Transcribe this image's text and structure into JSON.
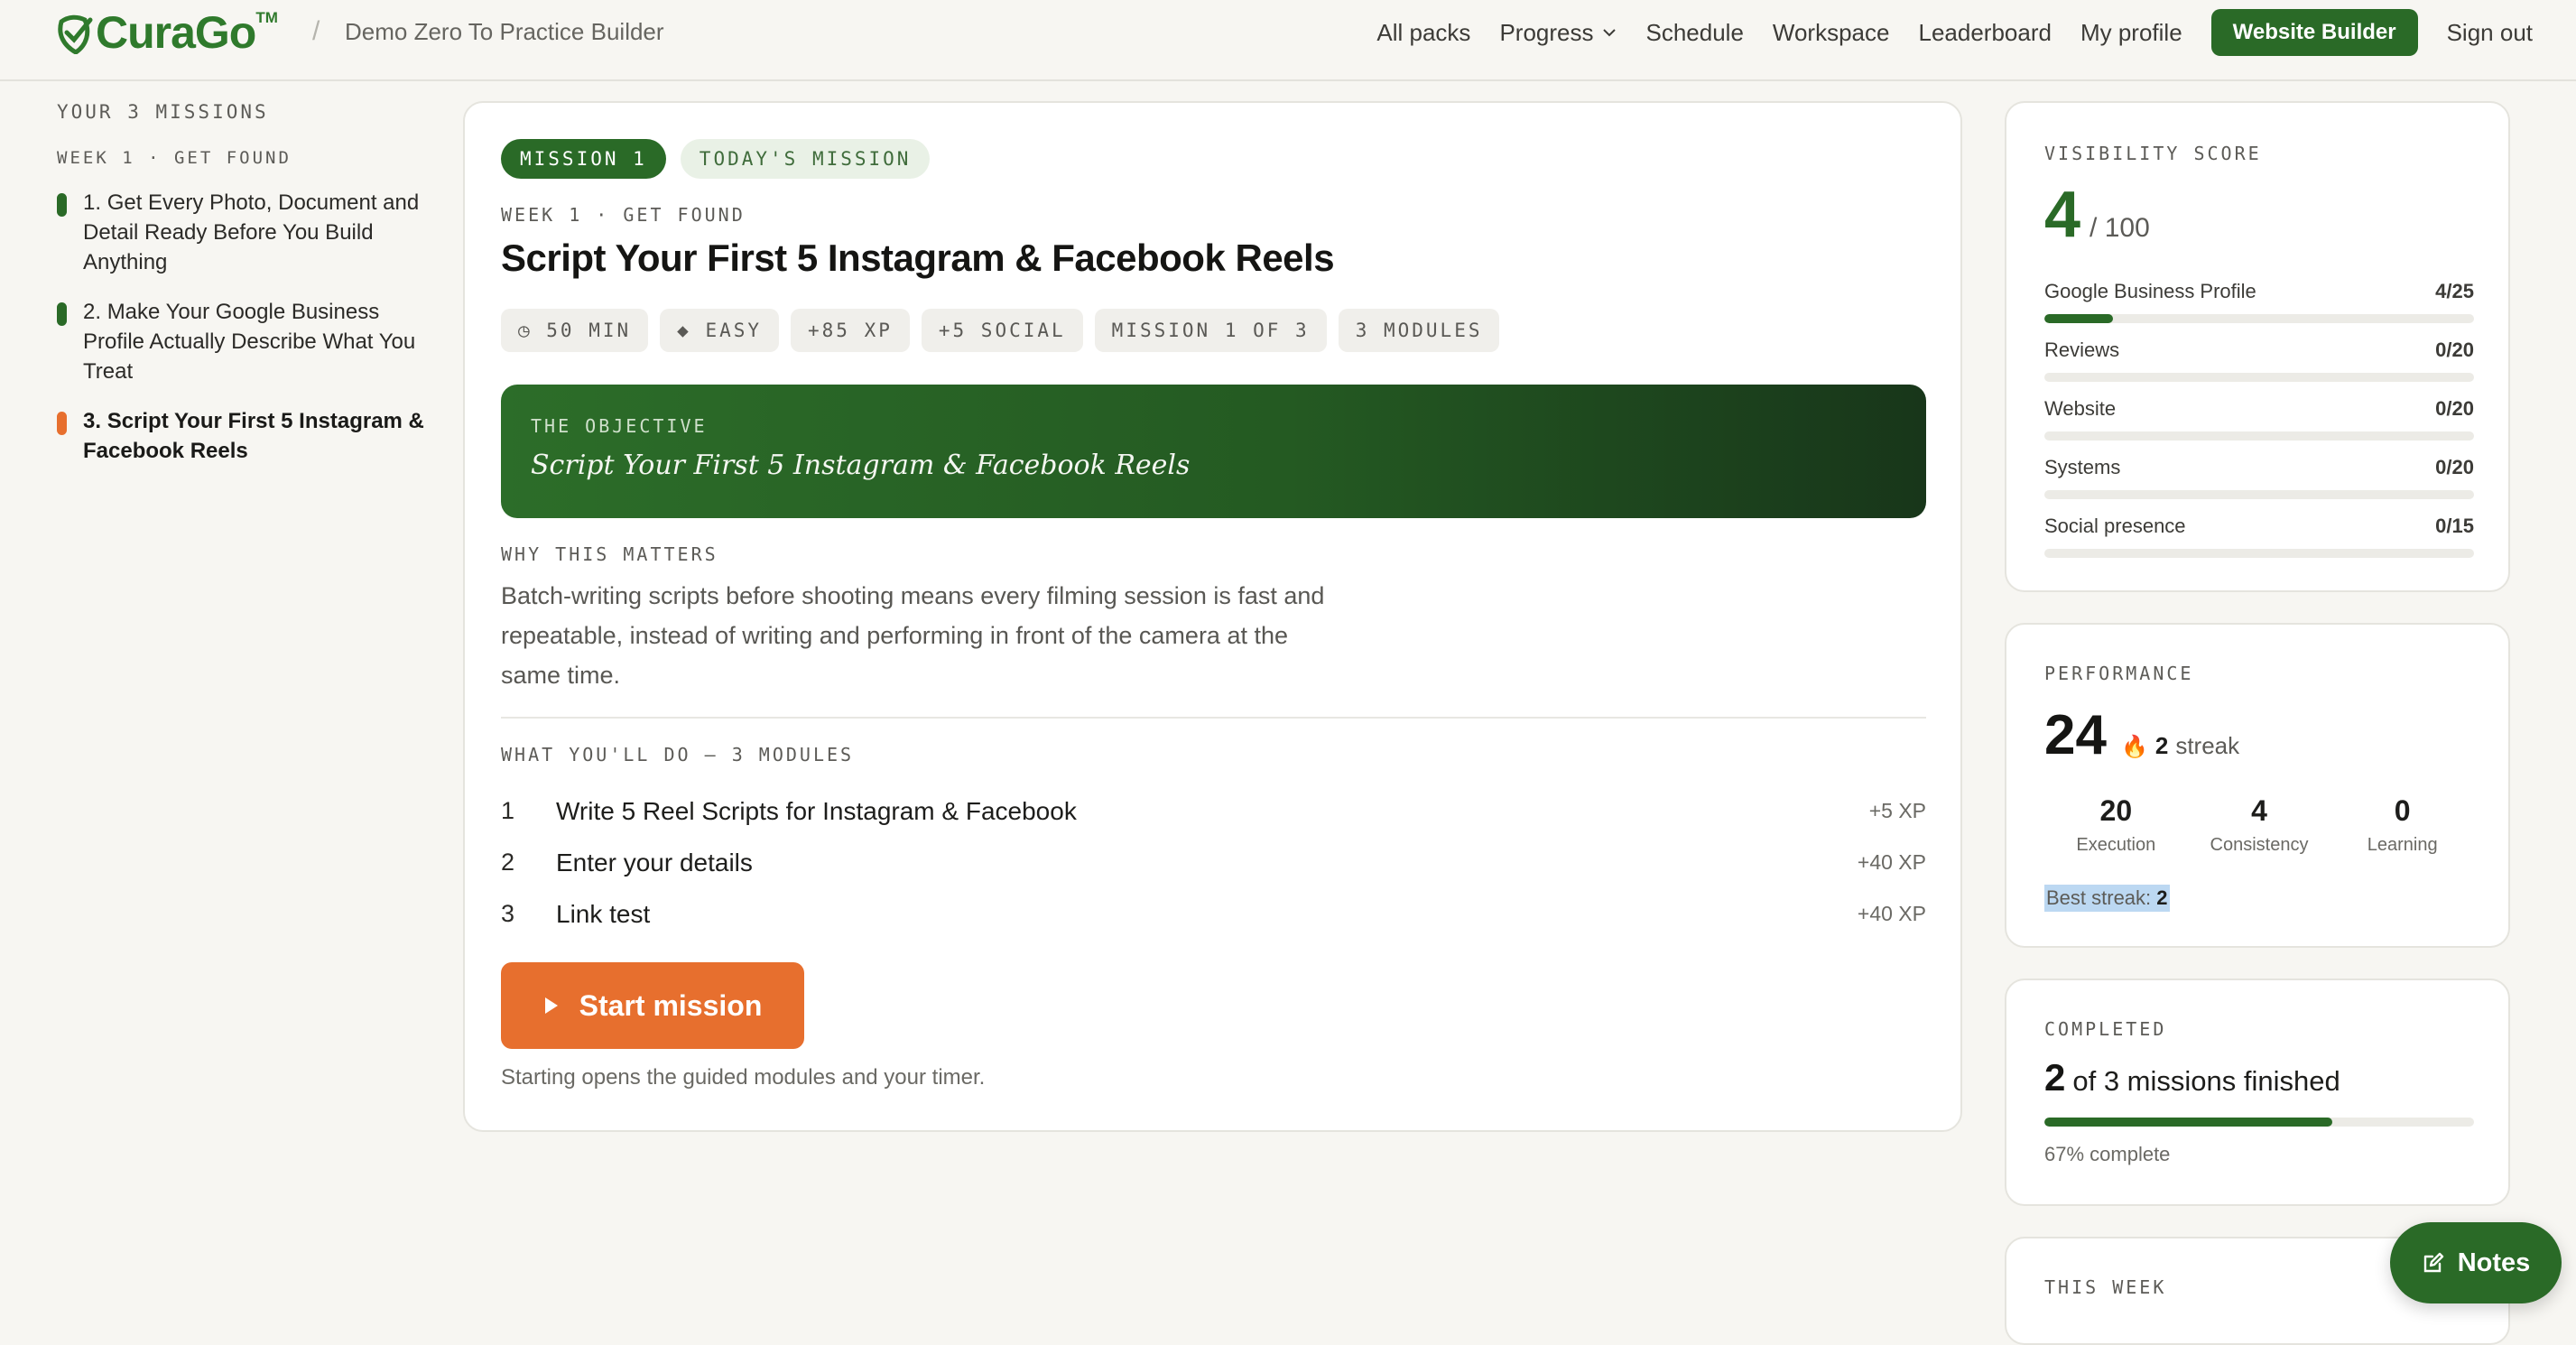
{
  "header": {
    "brand": "CuraGo",
    "brand_mark": "TM",
    "separator": "/",
    "workspace": "Demo Zero To Practice Builder",
    "nav": [
      "All packs",
      "Progress",
      "Schedule",
      "Workspace",
      "Leaderboard",
      "My profile"
    ],
    "cta": "Website Builder",
    "signout": "Sign out"
  },
  "sidebar": {
    "heading": "YOUR 3 MISSIONS",
    "week": "WEEK 1 · GET FOUND",
    "items": [
      {
        "num": "1.",
        "label": "Get Every Photo, Document and Detail Ready Before You Build Anything",
        "status": "done",
        "color": "#2a6a27"
      },
      {
        "num": "2.",
        "label": "Make Your Google Business Profile Actually Describe What You Treat",
        "status": "done",
        "color": "#2a6a27"
      },
      {
        "num": "3.",
        "label": "Script Your First 5 Instagram & Facebook Reels",
        "status": "current",
        "color": "#e76f2e"
      }
    ]
  },
  "mission": {
    "badge": "MISSION 1",
    "tag": "TODAY'S MISSION",
    "week": "WEEK 1 · GET FOUND",
    "title": "Script Your First 5 Instagram & Facebook Reels",
    "meta": [
      "◷ 50 MIN",
      "◆ EASY",
      "+85 XP",
      "+5 SOCIAL",
      "MISSION 1 OF 3",
      "3 MODULES"
    ],
    "objective_label": "THE OBJECTIVE",
    "objective": "Script Your First 5 Instagram & Facebook Reels",
    "why_label": "WHY THIS MATTERS",
    "why": "Batch-writing scripts before shooting means every filming session is fast and repeatable, instead of writing and performing in front of the camera at the same time.",
    "todo_label": "WHAT YOU'LL DO — 3 MODULES",
    "modules": [
      {
        "num": "1",
        "name": "Write 5 Reel Scripts for Instagram & Facebook",
        "xp": "+5 XP"
      },
      {
        "num": "2",
        "name": "Enter your details",
        "xp": "+40 XP"
      },
      {
        "num": "3",
        "name": "Link test",
        "xp": "+40 XP"
      }
    ],
    "start_label": "Start mission",
    "start_note": "Starting opens the guided modules and your timer."
  },
  "visibility": {
    "label": "VISIBILITY SCORE",
    "score": "4",
    "max": "/ 100",
    "rows": [
      {
        "name": "Google Business Profile",
        "value": "4/25",
        "fraction": 0.16
      },
      {
        "name": "Reviews",
        "value": "0/20",
        "fraction": 0
      },
      {
        "name": "Website",
        "value": "0/20",
        "fraction": 0
      },
      {
        "name": "Systems",
        "value": "0/20",
        "fraction": 0
      },
      {
        "name": "Social presence",
        "value": "0/15",
        "fraction": 0
      }
    ]
  },
  "performance": {
    "label": "PERFORMANCE",
    "score": "24",
    "streak_num": "2",
    "streak_word": "streak",
    "stats": [
      {
        "value": "20",
        "label": "Execution"
      },
      {
        "value": "4",
        "label": "Consistency"
      },
      {
        "value": "0",
        "label": "Learning"
      }
    ],
    "best_label": "Best streak:",
    "best_value": "2"
  },
  "completed": {
    "label": "COMPLETED",
    "count": "2",
    "text": "of 3 missions finished",
    "fraction": 0.67,
    "pct_text": "67% complete"
  },
  "this_week": {
    "label": "THIS WEEK"
  },
  "notes": {
    "label": "Notes"
  },
  "colors": {
    "brand_green": "#2a6a27",
    "accent_orange": "#e76f2e"
  }
}
